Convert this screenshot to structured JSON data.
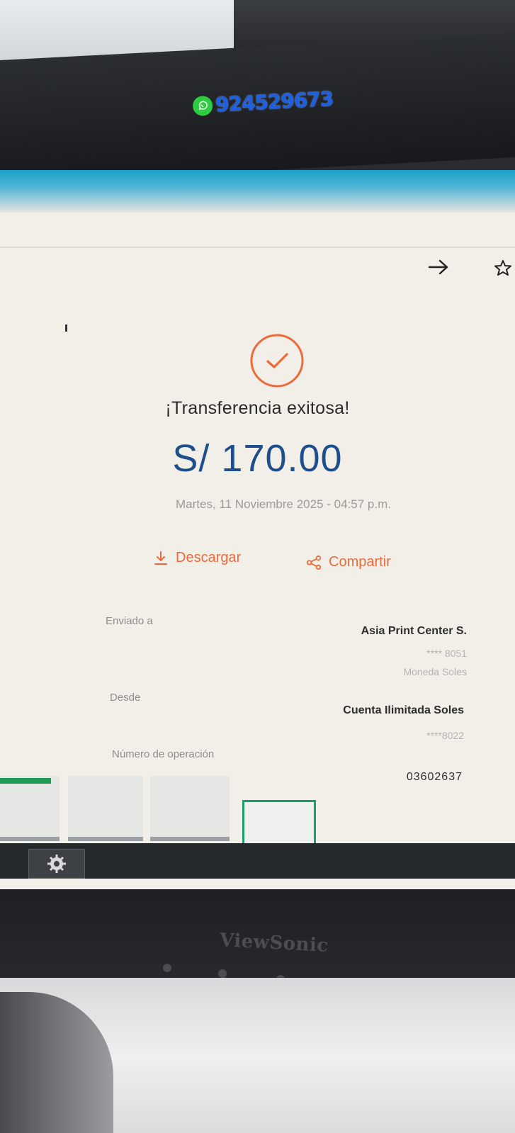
{
  "sticker": {
    "phone": "924529673"
  },
  "receipt": {
    "title": "¡Transferencia exitosa!",
    "amount": "S/ 170.00",
    "datetime": "Martes, 11 Noviembre 2025 - 04:57 p.m.",
    "actions": {
      "download_label": "Descargar",
      "share_label": "Compartir"
    },
    "sent_to": {
      "label": "Enviado a",
      "name": "Asia Print Center S.",
      "account_mask": "**** 8051",
      "currency": "Moneda Soles"
    },
    "from": {
      "label": "Desde",
      "account_name": "Cuenta Ilimitada Soles",
      "account_mask": "****8022"
    },
    "operation": {
      "label": "Número de operación",
      "number": "03602637"
    }
  },
  "monitor": {
    "brand": "ViewSonic"
  },
  "colors": {
    "accent": "#ec6a3c",
    "amount": "#1f4f8a",
    "thumb_highlight": "#1d9a6e"
  },
  "icons": [
    "whatsapp-icon",
    "arrow-right-icon",
    "star-icon",
    "check-circle-icon",
    "download-icon",
    "share-icon",
    "gear-icon"
  ]
}
